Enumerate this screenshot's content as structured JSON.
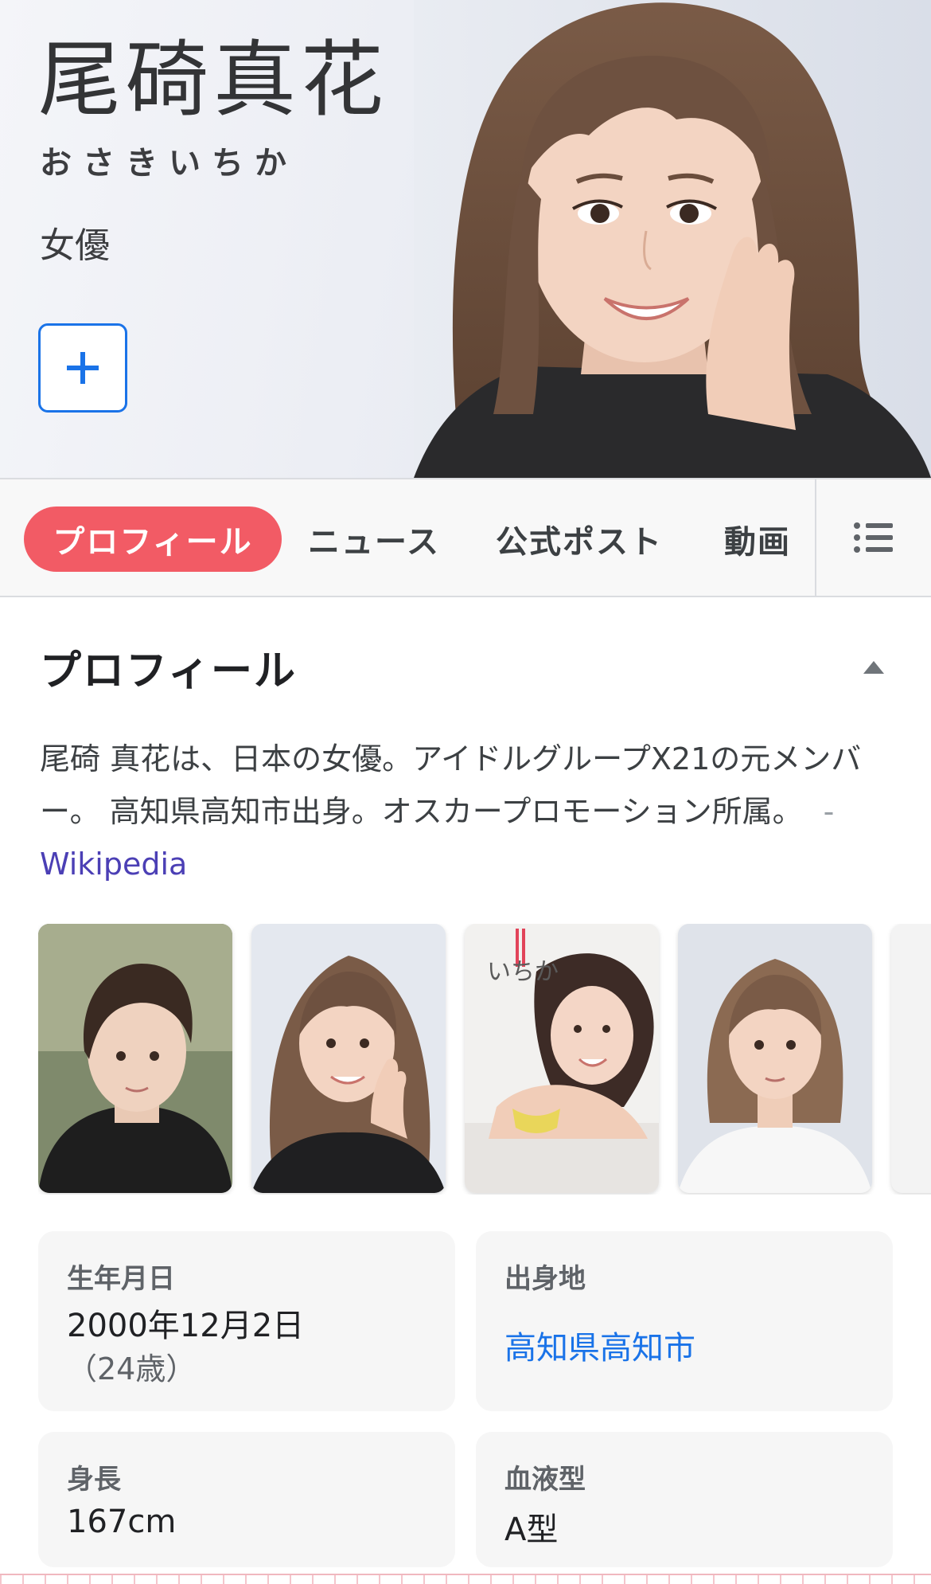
{
  "header": {
    "name": "尾碕真花",
    "kana": "おさきいちか",
    "occupation": "女優",
    "follow_icon": "plus-icon"
  },
  "tabs": [
    {
      "label": "プロフィール",
      "active": true
    },
    {
      "label": "ニュース",
      "active": false
    },
    {
      "label": "公式ポスト",
      "active": false
    },
    {
      "label": "動画",
      "active": false
    }
  ],
  "tab_menu_icon": "list-icon",
  "profile": {
    "title": "プロフィール",
    "collapse_icon": "triangle-up-icon",
    "description": "尾碕 真花は、日本の女優。アイドルグループX21の元メンバー。 高知県高知市出身。オスカープロモーション所属。",
    "source_dash": "-",
    "source_link": "Wikipedia"
  },
  "images": [
    {
      "label": "短髪の写真"
    },
    {
      "label": "頬杖の写真"
    },
    {
      "label": "写真集の表紙",
      "cover_text": "いちか"
    },
    {
      "label": "白いTシャツの写真"
    }
  ],
  "facts": {
    "birth": {
      "label": "生年月日",
      "value": "2000年12月2日",
      "sub": "（24歳）"
    },
    "birthplace": {
      "label": "出身地",
      "value": "高知県高知市"
    },
    "height": {
      "label": "身長",
      "value": "167cm"
    },
    "blood": {
      "label": "血液型",
      "value": "A型"
    }
  },
  "colors": {
    "accent_tab": "#f25b65",
    "link_blue": "#1a73e8",
    "wiki_link": "#4b3fb5"
  }
}
